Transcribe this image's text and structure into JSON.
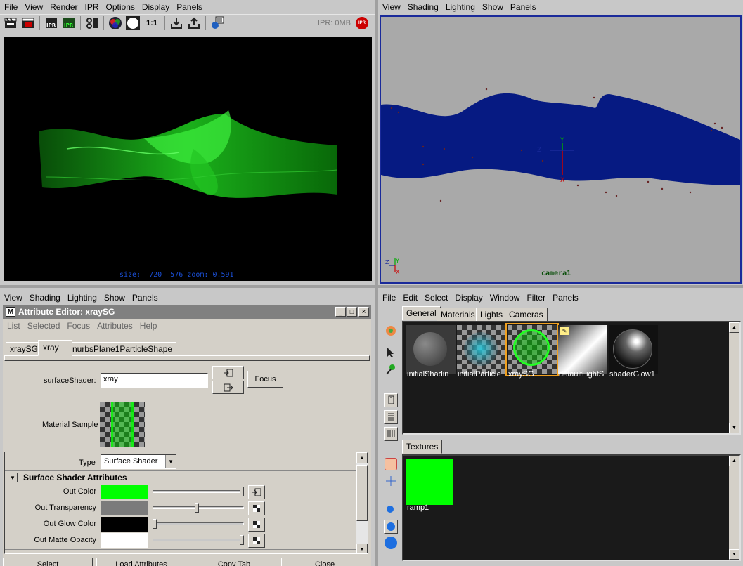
{
  "render_view": {
    "menu": [
      "File",
      "View",
      "Render",
      "IPR",
      "Options",
      "Display",
      "Panels"
    ],
    "ipr_status": "IPR: 0MB",
    "ratio_label": "1:1",
    "status_line": "size:  720  576 zoom: 0.591"
  },
  "persp_view": {
    "menu": [
      "View",
      "Shading",
      "Lighting",
      "Show",
      "Panels"
    ],
    "camera_label": "camera1"
  },
  "attr_panel": {
    "menu": [
      "View",
      "Shading",
      "Lighting",
      "Show",
      "Panels"
    ],
    "title": "Attribute Editor: xraySG",
    "submenu": [
      "List",
      "Selected",
      "Focus",
      "Attributes",
      "Help"
    ],
    "tabs": [
      "xraySG",
      "xray",
      "nurbsPlane1ParticleShape"
    ],
    "surface_shader_label": "surfaceShader:",
    "surface_shader_value": "xray",
    "focus_label": "Focus",
    "material_sample_label": "Material Sample",
    "type_label": "Type",
    "type_value": "Surface Shader",
    "section_title": "Surface Shader Attributes",
    "attrs": [
      {
        "label": "Out Color",
        "color": "#00ff00",
        "slider": 1.0
      },
      {
        "label": "Out Transparency",
        "color": "#7b7b7b",
        "slider": 0.48
      },
      {
        "label": "Out Glow Color",
        "color": "#000000",
        "slider": 0.0
      },
      {
        "label": "Out Matte Opacity",
        "color": "#ffffff",
        "slider": 1.0
      }
    ],
    "bottom_buttons": [
      "Select",
      "Load Attributes",
      "Copy Tab",
      "Close"
    ]
  },
  "hypershade": {
    "menu": [
      "File",
      "Edit",
      "Select",
      "Display",
      "Window",
      "Filter",
      "Panels"
    ],
    "top_tabs": [
      "General",
      "Materials",
      "Lights",
      "Cameras"
    ],
    "swatches": [
      "initialShadingGroup",
      "initialParticleSE",
      "xraySG",
      "defaultLightSet",
      "shaderGlow1"
    ],
    "swatch_labels": [
      "initialShadin",
      "initialParticle",
      "xraySG",
      "defaultLightS",
      "shaderGlow1"
    ],
    "bottom_tab": "Textures",
    "texture_label": "ramp1"
  }
}
